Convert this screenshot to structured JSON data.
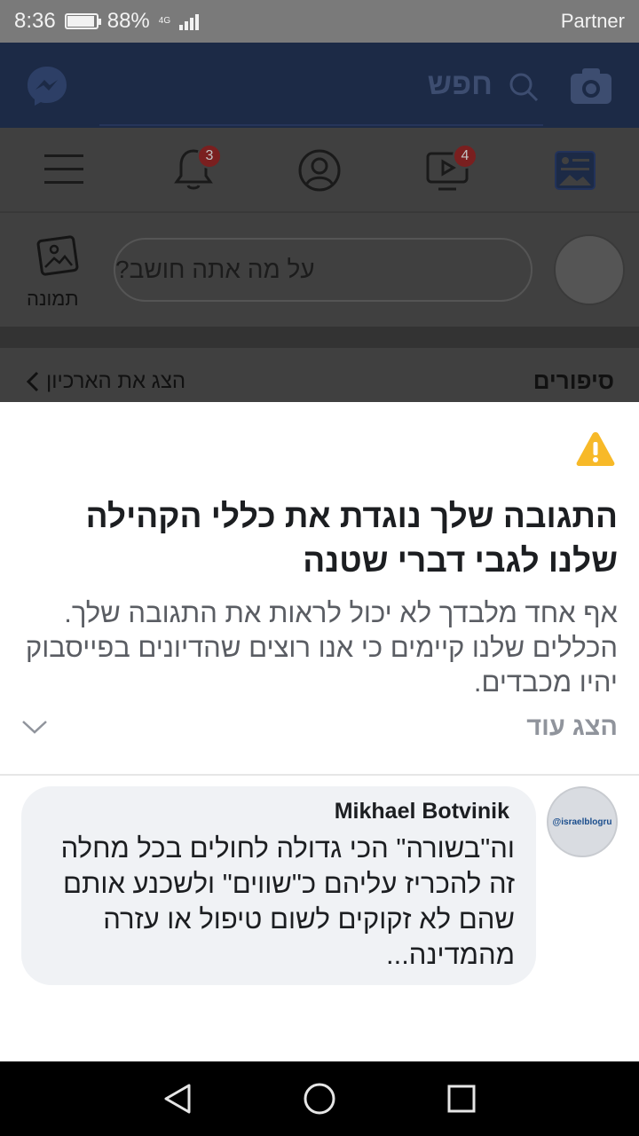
{
  "status_bar": {
    "time": "8:36",
    "battery_percent": "88%",
    "battery_level": 0.88,
    "network": "4G",
    "carrier": "Partner"
  },
  "facebook": {
    "search_placeholder": "חפש",
    "notifications_badge": "3",
    "video_badge": "4",
    "composer_placeholder": "על מה אתה חושב?",
    "photo_label": "תמונה",
    "stories_title": "סיפורים",
    "stories_archive_link": "הצג את הארכיון"
  },
  "sheet": {
    "icon": "warning-icon",
    "title": "התגובה שלך נוגדת את כללי הקהילה שלנו לגבי דברי שטנה",
    "description": "אף אחד מלבדך לא יכול לראות את התגובה שלך. הכללים שלנו קיימים כי אנו רוצים שהדיונים בפייסבוק יהיו מכבדים.",
    "show_more": "הצג עוד",
    "comment": {
      "avatar_text": "@israelblogru",
      "author": "Mikhael Botvinik",
      "text": "וה\"בשורה\" הכי גדולה לחולים בכל מחלה זה להכריז עליהם כ\"שווים\" ולשכנע אותם שהם לא זקוקים לשום טיפול או עזרה מהמדינה..."
    }
  },
  "colors": {
    "facebook_header": "#1c2a46",
    "warning_yellow": "#f7b928",
    "bubble_bg": "#f0f2f5"
  }
}
